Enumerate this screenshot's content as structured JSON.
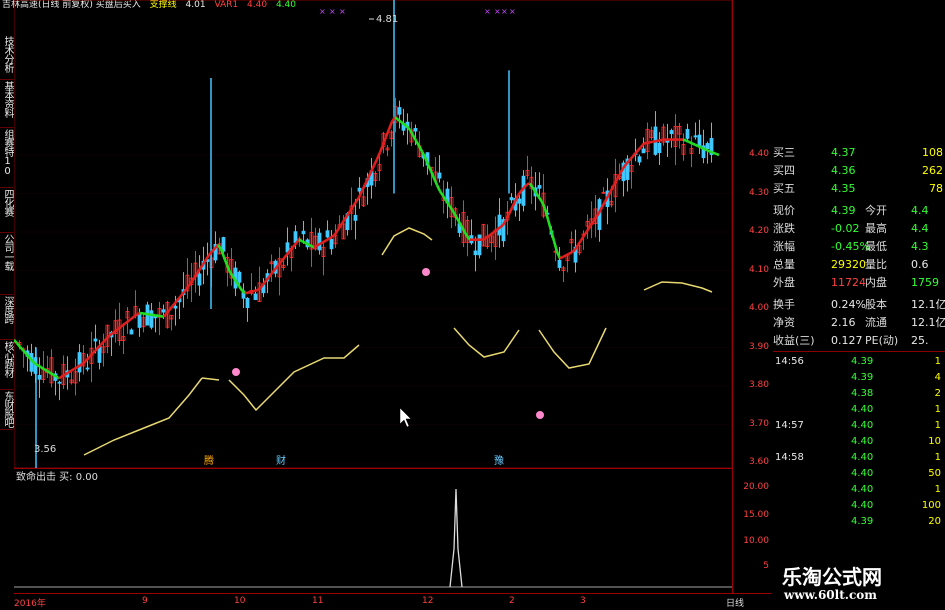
{
  "topbar": {
    "title": "吉林高速(日线 前复权) 买盘后买入",
    "support_label": "支撑线",
    "support_value": "4.01",
    "var_label": "VAR1",
    "var_value": "4.40",
    "ma_value": "4.40"
  },
  "sidebar": {
    "tabs": [
      "技术分析",
      "基本资料",
      "组赛特10",
      "四化赛",
      "公司一载",
      "深度跨",
      "核心题材",
      "东财股吧"
    ]
  },
  "main_chart": {
    "high_label": "4.81",
    "low_label": "3.56",
    "markers": [
      "腾",
      "财",
      "豫"
    ],
    "price_ticks": [
      "4.40",
      "4.30",
      "4.20",
      "4.10",
      "4.00",
      "3.90",
      "3.80",
      "3.70",
      "3.60"
    ]
  },
  "sub_chart": {
    "title": "致命出击 买: 0.00",
    "ticks": [
      "20.00",
      "15.00",
      "10.00",
      "5"
    ]
  },
  "time_axis": {
    "labels": [
      "2016年",
      "9",
      "10",
      "11",
      "12",
      "2",
      "3",
      "日线"
    ]
  },
  "quote": {
    "asks": [
      {
        "label": "买三",
        "price": "4.37",
        "vol": "108"
      },
      {
        "label": "买四",
        "price": "4.36",
        "vol": "262"
      },
      {
        "label": "买五",
        "price": "4.35",
        "vol": "78"
      }
    ],
    "stats": [
      {
        "l1": "现价",
        "v1": "4.39",
        "l2": "今开",
        "v2": "4.4"
      },
      {
        "l1": "涨跌",
        "v1": "-0.02",
        "l2": "最高",
        "v2": "4.4"
      },
      {
        "l1": "涨幅",
        "v1": "-0.45%",
        "l2": "最低",
        "v2": "4.3"
      },
      {
        "l1": "总量",
        "v1": "29320",
        "l2": "量比",
        "v2": "0.6"
      },
      {
        "l1": "外盘",
        "v1": "11724",
        "l2": "内盘",
        "v2": "1759"
      }
    ],
    "stats2": [
      {
        "l1": "换手",
        "v1": "0.24%",
        "l2": "股本",
        "v2": "12.1亿"
      },
      {
        "l1": "净资",
        "v1": "2.16",
        "l2": "流通",
        "v2": "12.1亿"
      },
      {
        "l1": "收益(三)",
        "v1": "0.127",
        "l2": "PE(动)",
        "v2": "25."
      }
    ],
    "ticks": [
      {
        "time": "14:56",
        "price": "4.39",
        "vol": "1"
      },
      {
        "time": "",
        "price": "4.39",
        "vol": "4"
      },
      {
        "time": "",
        "price": "4.38",
        "vol": "2"
      },
      {
        "time": "",
        "price": "4.40",
        "vol": "1"
      },
      {
        "time": "14:57",
        "price": "4.40",
        "vol": "1"
      },
      {
        "time": "",
        "price": "4.40",
        "vol": "10"
      },
      {
        "time": "14:58",
        "price": "4.40",
        "vol": "1"
      },
      {
        "time": "",
        "price": "4.40",
        "vol": "50"
      },
      {
        "time": "",
        "price": "4.40",
        "vol": "1"
      },
      {
        "time": "",
        "price": "4.40",
        "vol": "100"
      },
      {
        "time": "",
        "price": "4.39",
        "vol": "20"
      }
    ]
  },
  "watermark": {
    "line1": "乐淘公式网",
    "line2": "www.60lt.com"
  },
  "colors": {
    "up": "#ff3030",
    "down": "#33ff33",
    "ma_up": "#e02020",
    "ma_down": "#22dd22",
    "yellow_line": "#e8d870",
    "grid": "#800000"
  }
}
